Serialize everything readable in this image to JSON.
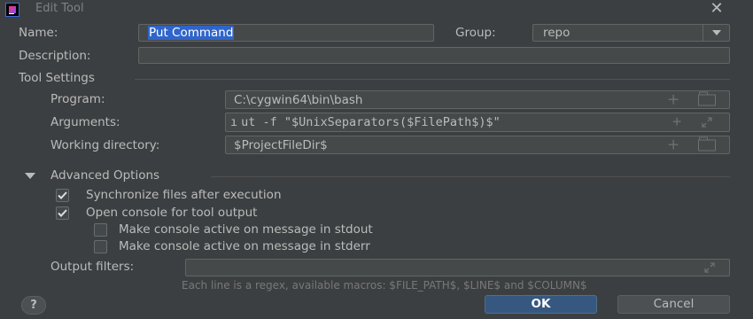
{
  "window": {
    "title": "Edit Tool",
    "close_glyph": "✕"
  },
  "form": {
    "name_label": "Name:",
    "name_value": "Put Command",
    "group_label": "Group:",
    "group_value": "repo",
    "description_label": "Description:",
    "description_value": ""
  },
  "tool_settings": {
    "section_title": "Tool Settings",
    "program_label": "Program:",
    "program_value": "C:\\cygwin64\\bin\\bash",
    "arguments_label": "Arguments:",
    "arguments_value": "ut  -f  \"$UnixSeparators($FilePath$)$\"",
    "arguments_prefix": "ı",
    "working_dir_label": "Working directory:",
    "working_dir_value": "$ProjectFileDir$",
    "add_glyph": "+"
  },
  "advanced": {
    "section_title": "Advanced Options",
    "options": [
      {
        "label": "Synchronize files after execution",
        "checked": true
      },
      {
        "label": "Open console for tool output",
        "checked": true
      },
      {
        "label": "Make console active on message in stdout",
        "checked": false
      },
      {
        "label": "Make console active on message in stderr",
        "checked": false
      }
    ],
    "output_filters_label": "Output filters:",
    "output_filters_value": "",
    "hint": "Each line is a regex, available macros: $FILE_PATH$, $LINE$ and $COLUMN$"
  },
  "footer": {
    "help_label": "?",
    "ok_label": "OK",
    "cancel_label": "Cancel"
  },
  "colors": {
    "background": "#3c3f41",
    "field_bg": "#45494a",
    "selection": "#2f65ca",
    "ok_button": "#365880"
  },
  "icons": [
    "app-logo-icon",
    "close-icon",
    "chevron-down-icon",
    "add-icon",
    "folder-icon",
    "expand-icon",
    "triangle-down-icon",
    "checkmark-icon",
    "help-icon"
  ]
}
